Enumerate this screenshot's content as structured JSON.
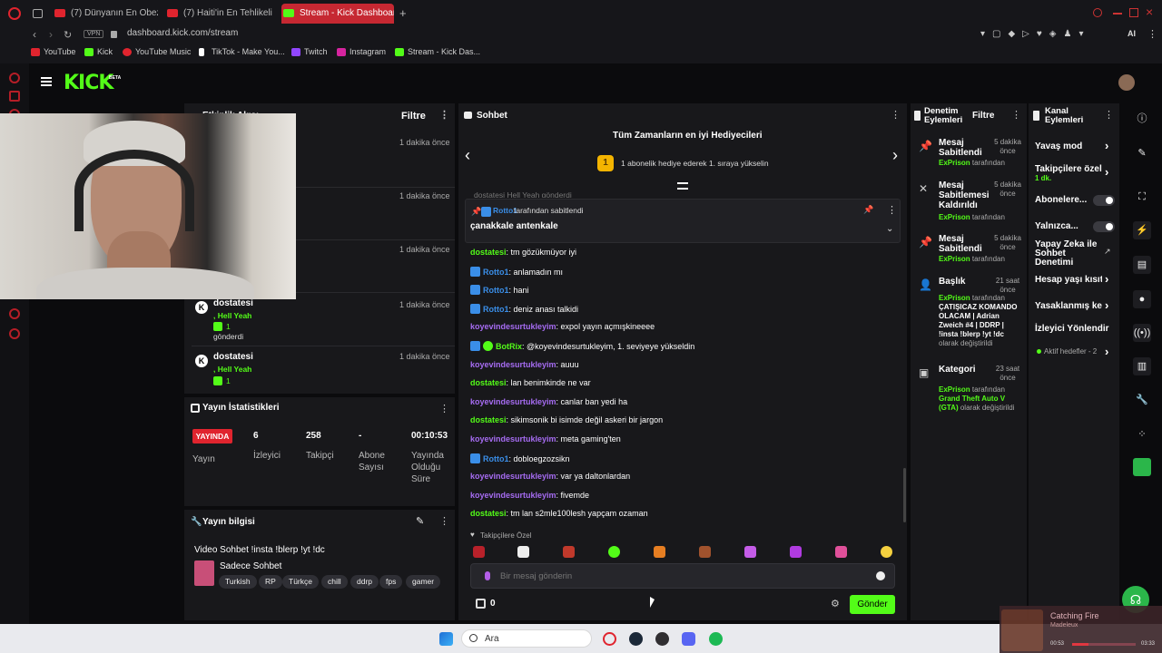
{
  "browser": {
    "tabs": [
      {
        "label": "(7) Dünyanın En Obez Şehr"
      },
      {
        "label": "(7) Haiti'in En Tehlikeli Çet"
      },
      {
        "label": "Stream - Kick Dashboard"
      }
    ],
    "vpn": "VPN",
    "url": "dashboard.kick.com/stream",
    "bookmarks": [
      {
        "label": "YouTube",
        "color": "#e0242e"
      },
      {
        "label": "Kick",
        "color": "#53fc18"
      },
      {
        "label": "YouTube Music",
        "color": "#e0242e"
      },
      {
        "label": "TikTok - Make You...",
        "color": "#ffffff"
      },
      {
        "label": "Twitch",
        "color": "#9146ff"
      },
      {
        "label": "Instagram",
        "color": "#d6249f"
      },
      {
        "label": "Stream - Kick Das...",
        "color": "#53fc18"
      }
    ],
    "ai_label": "AI"
  },
  "header": {
    "logo": "KICK",
    "beta": "BETA"
  },
  "activity": {
    "title": "Etkinlik Akışı",
    "filter": "Filtre",
    "items": [
      {
        "time": "1 dakika önce"
      },
      {
        "time": "1 dakika önce"
      },
      {
        "time": "1 dakika önce"
      },
      {
        "user": "dostatesi",
        "gift": ", Hell Yeah",
        "count": "1",
        "sent": "gönderdi",
        "time": "1 dakika önce"
      },
      {
        "user": "dostatesi",
        "gift": ", Hell Yeah",
        "count": "1",
        "time": "1 dakika önce"
      }
    ]
  },
  "stats": {
    "title": "Yayın İstatistikleri",
    "live": "YAYINDA",
    "stream_label": "Yayın",
    "viewers": "6",
    "viewers_label": "İzleyici",
    "followers": "258",
    "followers_label": "Takipçi",
    "subs": "-",
    "subs_label": "Abone Sayısı",
    "uptime": "00:10:53",
    "uptime_label": "Yayında Olduğu Süre"
  },
  "info": {
    "title": "Yayın bilgisi",
    "stream_title": "Video Sohbet !insta !blerp !yt !dc",
    "category": "Sadece Sohbet",
    "tags": [
      "Turkish",
      "RP",
      "Türkçe",
      "chill",
      "ddrp",
      "fps",
      "gamer"
    ]
  },
  "chat": {
    "title": "Sohbet",
    "gifters_title": "Tüm Zamanların en iyi Hediyecileri",
    "rank": "1",
    "gifter_text": "1 abonelik hediye ederek 1. sıraya yükselin",
    "pinned_by": "Rotto1",
    "pinned_suffix": " tarafından sabitlendi",
    "pinned_text": "çanakkale antenkale",
    "partial_top": "dostatesi Hell Yeah gönderdi",
    "messages": [
      {
        "user": "dostatesi",
        "color": "#53fc18",
        "mod": false,
        "text": ": tm gözükmüyor iyi"
      },
      {
        "user": "Rotto1",
        "color": "#3a8ee8",
        "mod": true,
        "text": ": anlamadın mı"
      },
      {
        "user": "Rotto1",
        "color": "#3a8ee8",
        "mod": true,
        "text": ": hani"
      },
      {
        "user": "Rotto1",
        "color": "#3a8ee8",
        "mod": true,
        "text": ": deniz anası talkidi"
      },
      {
        "user": "koyevindesurtukleyim",
        "color": "#a66cf2",
        "mod": false,
        "text": ": expol yayın açmışkineeee"
      },
      {
        "user": "BotRix",
        "color": "#53fc18",
        "mod": true,
        "text": ": @koyevindesurtukleyim, 1. seviyeye yükseldin"
      },
      {
        "user": "koyevindesurtukleyim",
        "color": "#a66cf2",
        "mod": false,
        "text": ": auuu"
      },
      {
        "user": "dostatesi",
        "color": "#53fc18",
        "mod": false,
        "text": ": lan benimkinde ne var"
      },
      {
        "user": "koyevindesurtukleyim",
        "color": "#a66cf2",
        "mod": false,
        "text": ": canlar ban yedi ha"
      },
      {
        "user": "dostatesi",
        "color": "#53fc18",
        "mod": false,
        "text": ": sikimsonik bi isimde değil askeri bir jargon"
      },
      {
        "user": "koyevindesurtukleyim",
        "color": "#a66cf2",
        "mod": false,
        "text": ": meta gaming'ten"
      },
      {
        "user": "Rotto1",
        "color": "#3a8ee8",
        "mod": true,
        "text": ": dobloegzozsikn"
      },
      {
        "user": "koyevindesurtukleyim",
        "color": "#a66cf2",
        "mod": false,
        "text": ": var ya daltonlardan"
      },
      {
        "user": "koyevindesurtukleyim",
        "color": "#a66cf2",
        "mod": false,
        "text": ": fivemde"
      },
      {
        "user": "dostatesi",
        "color": "#53fc18",
        "mod": false,
        "text": ": tm lan s2mle100lesh yapçam ozaman"
      }
    ],
    "followers_only": "Takipçilere Özel",
    "placeholder": "Bir mesaj gönderin",
    "points": "0",
    "send": "Gönder"
  },
  "mod": {
    "title": "Denetim Eylemleri",
    "filter": "Filtre",
    "events": [
      {
        "title": "Mesaj Sabitlendi",
        "time": "5 dakika önce",
        "by": "ExPrison",
        "suffix": " tarafından"
      },
      {
        "title": "Mesaj Sabitlemesi Kaldırıldı",
        "time": "5 dakika önce",
        "by": "ExPrison",
        "suffix": " tarafından"
      },
      {
        "title": "Mesaj Sabitlendi",
        "time": "5 dakika önce",
        "by": "ExPrison",
        "suffix": " tarafından"
      },
      {
        "title": "Başlık",
        "time": "21 saat önce",
        "by": "ExPrison",
        "suffix": " tarafından",
        "value": "ÇATIŞICAZ KOMANDO OLACAM | Adrian Zweich #4 | DDRP | !insta !blerp !yt !dc",
        "tail": " olarak değiştirildi"
      },
      {
        "title": "Kategori",
        "time": "23 saat önce",
        "by": "ExPrison",
        "suffix": " tarafından",
        "value": "Grand Theft Auto V (GTA)",
        "tail": " olarak değiştirildi"
      }
    ]
  },
  "channel": {
    "title": "Kanal Eylemleri",
    "items": [
      {
        "label": "Yavaş mod"
      },
      {
        "label": "Takipçilere özel",
        "sub": "1 dk."
      },
      {
        "label": "Abonelere..."
      },
      {
        "label": "Yalnızca..."
      },
      {
        "label": "Yapay Zeka ile Sohbet Denetimi"
      },
      {
        "label": "Hesap yaşı kısıtl"
      },
      {
        "label": "Yasaklanmış kel"
      },
      {
        "label": "İzleyici Yönlendir"
      }
    ],
    "active_targets": "Aktif hedefler - 2"
  },
  "taskbar": {
    "search": "Ara"
  },
  "media": {
    "title": "Catching Fire",
    "artist": "Madeleux",
    "elapsed": "00:53",
    "total": "03:33"
  }
}
